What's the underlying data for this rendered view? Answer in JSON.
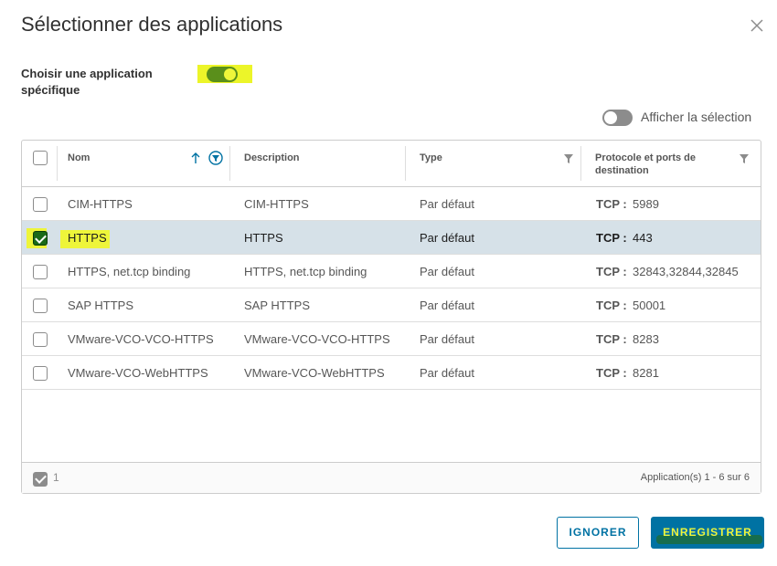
{
  "dialog": {
    "title": "Sélectionner des applications"
  },
  "specific": {
    "label": "Choisir une application spécifique",
    "toggle_on": true
  },
  "show_selection": {
    "label": "Afficher la sélection",
    "toggle_on": false
  },
  "grid": {
    "headers": {
      "name": "Nom",
      "description": "Description",
      "type": "Type",
      "protocol": "Protocole et ports de destination"
    },
    "rows": [
      {
        "name": "CIM-HTTPS",
        "description": "CIM-HTTPS",
        "type": "Par défaut",
        "proto": "TCP :",
        "port": "5989",
        "checked": false
      },
      {
        "name": "HTTPS",
        "description": "HTTPS",
        "type": "Par défaut",
        "proto": "TCP :",
        "port": "443",
        "checked": true
      },
      {
        "name": "HTTPS, net.tcp binding",
        "description": "HTTPS, net.tcp binding",
        "type": "Par défaut",
        "proto": "TCP :",
        "port": "32843,32844,32845",
        "checked": false
      },
      {
        "name": "SAP HTTPS",
        "description": "SAP HTTPS",
        "type": "Par défaut",
        "proto": "TCP :",
        "port": "50001",
        "checked": false
      },
      {
        "name": "VMware-VCO-VCO-HTTPS",
        "description": "VMware-VCO-VCO-HTTPS",
        "type": "Par défaut",
        "proto": "TCP :",
        "port": "8283",
        "checked": false
      },
      {
        "name": "VMware-VCO-WebHTTPS",
        "description": "VMware-VCO-WebHTTPS",
        "type": "Par défaut",
        "proto": "TCP :",
        "port": "8281",
        "checked": false
      }
    ],
    "footer": {
      "selected_count": "1",
      "pagination": "Application(s) 1 - 6 sur 6"
    }
  },
  "buttons": {
    "ignore": "IGNORER",
    "save": "ENREGISTRER"
  },
  "colors": {
    "accent": "#0072a3",
    "selected_row": "#d6e1e8",
    "highlight": "#eef53a",
    "check_green": "#1a6a18"
  },
  "icons": {
    "close": "close-icon",
    "sort": "arrow-up-icon",
    "filter": "filter-icon",
    "checkbox": "checkbox-icon"
  }
}
